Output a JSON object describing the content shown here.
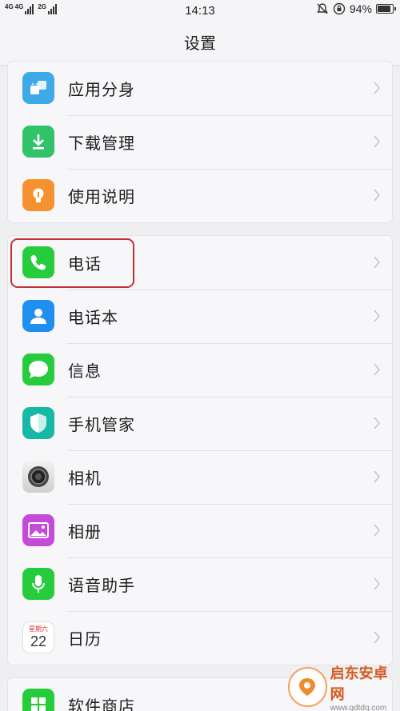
{
  "status_bar": {
    "network_left": "4G",
    "network_mid": "4G",
    "network_right": "2G",
    "time": "14:13",
    "battery_pct": "94%",
    "battery_level": 0.94
  },
  "header": {
    "title": "设置"
  },
  "groups": [
    {
      "items": [
        {
          "label": "应用分身",
          "icon": "android-clone-icon",
          "color": "#3fa9e8"
        },
        {
          "label": "下载管理",
          "icon": "download-icon",
          "color": "#32c36a"
        },
        {
          "label": "使用说明",
          "icon": "lightbulb-icon",
          "color": "#f5922f"
        }
      ]
    },
    {
      "items": [
        {
          "label": "电话",
          "icon": "phone-icon",
          "color": "#27cc3c"
        },
        {
          "label": "电话本",
          "icon": "contacts-icon",
          "color": "#1f8ff0"
        },
        {
          "label": "信息",
          "icon": "message-icon",
          "color": "#27cc3c"
        },
        {
          "label": "手机管家",
          "icon": "shield-icon",
          "color": "#17b8a5"
        },
        {
          "label": "相机",
          "icon": "camera-icon",
          "color": "#444444"
        },
        {
          "label": "相册",
          "icon": "gallery-icon",
          "color": "#c54ad8"
        },
        {
          "label": "语音助手",
          "icon": "microphone-icon",
          "color": "#27cc3c"
        },
        {
          "label": "日历",
          "icon": "calendar-icon",
          "color": "#ffffff",
          "day_label": "星期六",
          "day_number": "22"
        }
      ]
    },
    {
      "items": [
        {
          "label": "软件商店",
          "icon": "app-store-icon",
          "color": "#27cc3c"
        }
      ]
    }
  ],
  "watermark": {
    "name": "启东安卓网",
    "url": "www.qdtdq.com"
  }
}
